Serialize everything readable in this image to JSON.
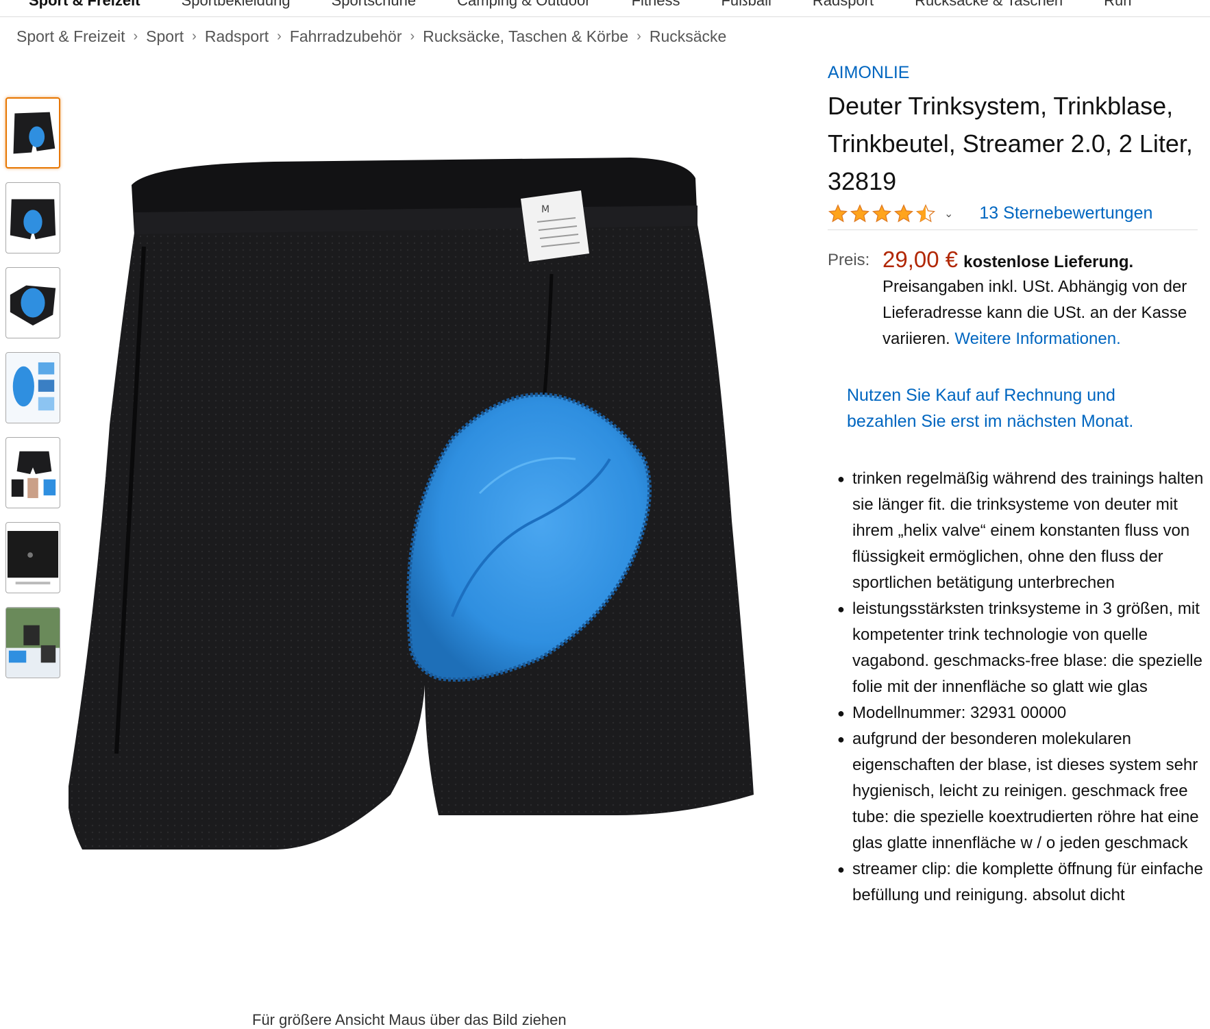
{
  "topnav": {
    "items": [
      "Sport & Freizeit",
      "Sportbekleidung",
      "Sportschuhe",
      "Camping & Outdoor",
      "Fitness",
      "Fußball",
      "Radsport",
      "Rucksäcke & Taschen",
      "Run"
    ]
  },
  "breadcrumb": {
    "items": [
      "Sport & Freizeit",
      "Sport",
      "Radsport",
      "Fahrradzubehör",
      "Rucksäcke, Taschen & Körbe",
      "Rucksäcke"
    ],
    "separator": "›"
  },
  "gallery": {
    "thumbnails": [
      "shorts-front-thumb",
      "shorts-back-thumb",
      "pad-closeup-thumb",
      "pad-detail-thumb",
      "model-wearing-thumb",
      "fabric-detail-thumb",
      "riding-scene-thumb"
    ],
    "selected_index": 0,
    "zoom_hint": "Für größere Ansicht Maus über das Bild ziehen"
  },
  "product": {
    "brand": "AIMONLIE",
    "title": "Deuter Trinksystem, Trinkblase, Trinkbeutel, Streamer 2.0, 2 Liter, 32819",
    "rating": 4.5,
    "ratings_count_label": "13 Sternebewertungen",
    "price_label": "Preis:",
    "price": "29,00 €",
    "shipping": "kostenlose Lieferung.",
    "tax_note": "Preisangaben inkl. USt. Abhängig von der Lieferadresse kann die USt. an der Kasse variieren.",
    "more_info_link": "Weitere Informationen.",
    "invoice_promo": "Nutzen Sie Kauf auf Rechnung und bezahlen Sie erst im nächsten Monat.",
    "bullets": [
      "trinken regelmäßig während des trainings halten sie länger fit. die trinksysteme von deuter mit ihrem „helix valve“ einem konstanten fluss von flüssigkeit ermöglichen, ohne den fluss der sportlichen betätigung unterbrechen",
      "leistungsstärksten trinksysteme in 3 größen, mit kompetenter trink technologie von quelle vagabond. geschmacks-free blase: die spezielle folie mit der innenfläche so glatt wie glas",
      "Modellnummer: 32931 00000",
      "aufgrund der besonderen molekularen eigenschaften der blase, ist dieses system sehr hygienisch, leicht zu reinigen. geschmack free tube: die spezielle koextrudierten röhre hat eine glas glatte innenfläche w / o jeden geschmack",
      "streamer clip: die komplette öffnung für einfache befüllung und reinigung. absolut dicht"
    ]
  },
  "colors": {
    "link": "#0066c0",
    "price": "#b12704",
    "star": "#ffa41c",
    "thumb_selected": "#e77600",
    "pad_blue": "#2f8fe0"
  },
  "icons": {
    "star": "star-icon",
    "chevron": "chevron-down-icon",
    "breadcrumb_separator": "chevron-right-icon",
    "bullet": "bullet-dot"
  }
}
